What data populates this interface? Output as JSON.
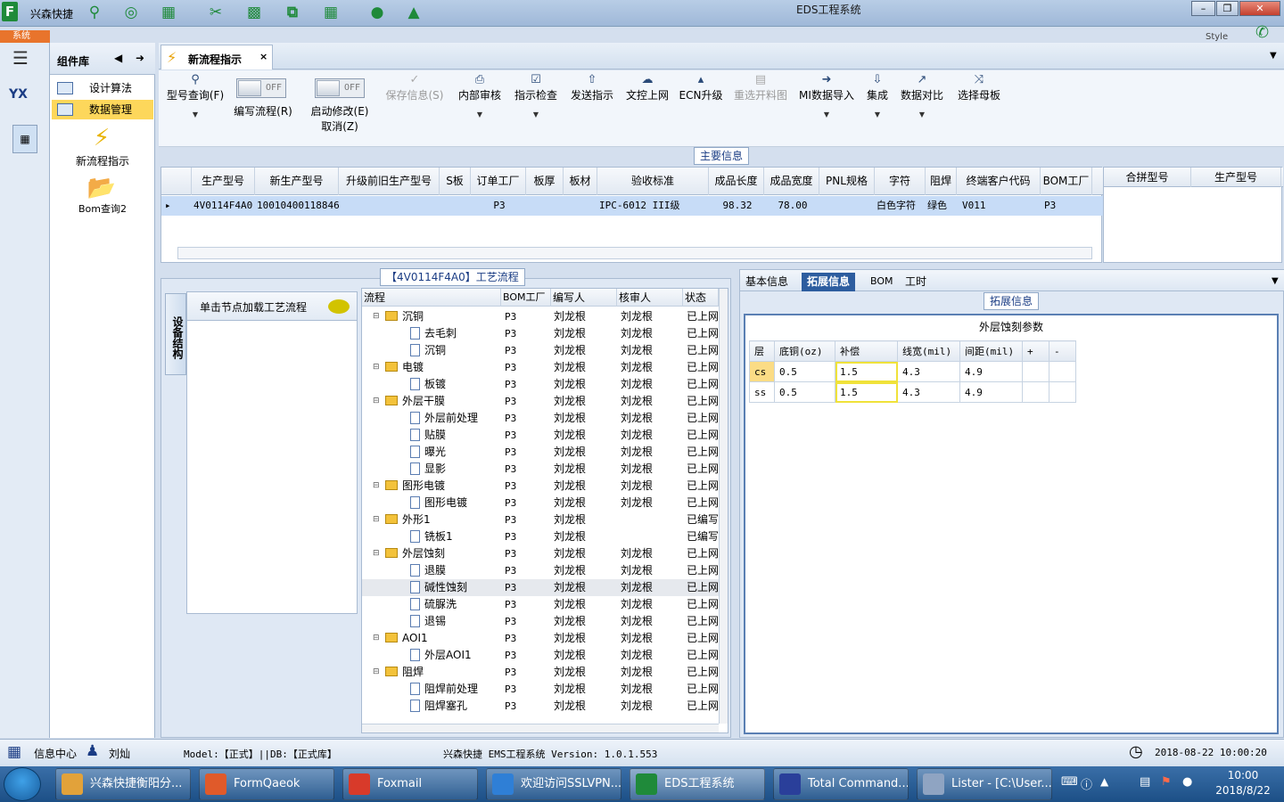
{
  "app": {
    "logo_letter": "F",
    "name": "兴森快捷",
    "window_title": "EDS工程系统",
    "menu_tab": "系统",
    "style_label": "Style"
  },
  "sidebar": {
    "logo_text": "YX",
    "panel_title": "组件库",
    "items": [
      {
        "label": "设计算法"
      },
      {
        "label": "数据管理",
        "selected": true
      }
    ],
    "big_items": [
      {
        "label": "新流程指示",
        "icon": "lightning-icon"
      },
      {
        "label": "Bom查询2",
        "icon": "folder-open-icon"
      }
    ]
  },
  "doc_tab": {
    "label": "新流程指示",
    "close": "×"
  },
  "toolbar": {
    "buttons": [
      {
        "label": "型号查询(F)",
        "icon": "search-icon",
        "dropdown": true
      },
      {
        "label": "编写流程(R)",
        "toggle": "OFF"
      },
      {
        "label": "启动修改(E)",
        "label2": "取消(Z)",
        "toggle": "OFF"
      },
      {
        "label": "保存信息(S)",
        "icon": "check-icon",
        "disabled": true
      },
      {
        "label": "内部审核",
        "icon": "print-icon",
        "dropdown": true
      },
      {
        "label": "指示检查",
        "icon": "checkbox-icon",
        "dropdown": true
      },
      {
        "label": "发送指示",
        "icon": "upload-icon"
      },
      {
        "label": "文控上网",
        "icon": "cloud-upload-icon"
      },
      {
        "label": "ECN升级",
        "icon": "ecn-icon"
      },
      {
        "label": "重选开料图",
        "icon": "image-icon",
        "disabled": true
      },
      {
        "label": "MI数据导入",
        "icon": "import-icon",
        "dropdown": true
      },
      {
        "label": "集成",
        "icon": "download-icon",
        "dropdown": true
      },
      {
        "label": "数据对比",
        "icon": "compare-icon",
        "dropdown": true
      },
      {
        "label": "选择母板",
        "icon": "shuffle-icon"
      }
    ]
  },
  "main_info": {
    "section_label": "主要信息",
    "columns": [
      "生产型号",
      "新生产型号",
      "升级前旧生产型号",
      "S板",
      "订单工厂",
      "板厚",
      "板材",
      "验收标准",
      "成品长度",
      "成品宽度",
      "PNL规格",
      "字符",
      "阻焊",
      "终端客户代码",
      "BOM工厂"
    ],
    "rows": [
      [
        "4V0114F4A0",
        "10010400118846",
        "",
        "",
        "P3",
        "",
        "",
        "IPC-6012 III级",
        "98.32",
        "78.00",
        "",
        "白色字符",
        "绿色",
        "V011",
        "P3"
      ]
    ],
    "merge_columns": [
      "合拼型号",
      "生产型号"
    ]
  },
  "process": {
    "title": "【4V0114F4A0】工艺流程",
    "vertical_tab": "设备结构",
    "node_hint": "单击节点加载工艺流程",
    "columns": [
      "流程",
      "BOM工厂",
      "编写人",
      "核审人",
      "状态"
    ],
    "rows": [
      {
        "name": "沉铜",
        "level": 0,
        "factory": "P3",
        "writer": "刘龙根",
        "reviewer": "刘龙根",
        "status": "已上网"
      },
      {
        "name": "去毛刺",
        "level": 1,
        "factory": "P3",
        "writer": "刘龙根",
        "reviewer": "刘龙根",
        "status": "已上网"
      },
      {
        "name": "沉铜",
        "level": 1,
        "factory": "P3",
        "writer": "刘龙根",
        "reviewer": "刘龙根",
        "status": "已上网"
      },
      {
        "name": "电镀",
        "level": 0,
        "factory": "P3",
        "writer": "刘龙根",
        "reviewer": "刘龙根",
        "status": "已上网"
      },
      {
        "name": "板镀",
        "level": 1,
        "factory": "P3",
        "writer": "刘龙根",
        "reviewer": "刘龙根",
        "status": "已上网"
      },
      {
        "name": "外层干膜",
        "level": 0,
        "factory": "P3",
        "writer": "刘龙根",
        "reviewer": "刘龙根",
        "status": "已上网"
      },
      {
        "name": "外层前处理",
        "level": 1,
        "factory": "P3",
        "writer": "刘龙根",
        "reviewer": "刘龙根",
        "status": "已上网"
      },
      {
        "name": "贴膜",
        "level": 1,
        "factory": "P3",
        "writer": "刘龙根",
        "reviewer": "刘龙根",
        "status": "已上网"
      },
      {
        "name": "曝光",
        "level": 1,
        "factory": "P3",
        "writer": "刘龙根",
        "reviewer": "刘龙根",
        "status": "已上网"
      },
      {
        "name": "显影",
        "level": 1,
        "factory": "P3",
        "writer": "刘龙根",
        "reviewer": "刘龙根",
        "status": "已上网"
      },
      {
        "name": "图形电镀",
        "level": 0,
        "factory": "P3",
        "writer": "刘龙根",
        "reviewer": "刘龙根",
        "status": "已上网"
      },
      {
        "name": "图形电镀",
        "level": 1,
        "factory": "P3",
        "writer": "刘龙根",
        "reviewer": "刘龙根",
        "status": "已上网"
      },
      {
        "name": "外形1",
        "level": 0,
        "factory": "P3",
        "writer": "刘龙根",
        "reviewer": "",
        "status": "已编写"
      },
      {
        "name": "铣板1",
        "level": 1,
        "factory": "P3",
        "writer": "刘龙根",
        "reviewer": "",
        "status": "已编写"
      },
      {
        "name": "外层蚀刻",
        "level": 0,
        "factory": "P3",
        "writer": "刘龙根",
        "reviewer": "刘龙根",
        "status": "已上网"
      },
      {
        "name": "退膜",
        "level": 1,
        "factory": "P3",
        "writer": "刘龙根",
        "reviewer": "刘龙根",
        "status": "已上网"
      },
      {
        "name": "碱性蚀刻",
        "level": 1,
        "factory": "P3",
        "writer": "刘龙根",
        "reviewer": "刘龙根",
        "status": "已上网",
        "highlight": true
      },
      {
        "name": "硫脲洗",
        "level": 1,
        "factory": "P3",
        "writer": "刘龙根",
        "reviewer": "刘龙根",
        "status": "已上网"
      },
      {
        "name": "退锡",
        "level": 1,
        "factory": "P3",
        "writer": "刘龙根",
        "reviewer": "刘龙根",
        "status": "已上网"
      },
      {
        "name": "AOI1",
        "level": 0,
        "factory": "P3",
        "writer": "刘龙根",
        "reviewer": "刘龙根",
        "status": "已上网"
      },
      {
        "name": "外层AOI1",
        "level": 1,
        "factory": "P3",
        "writer": "刘龙根",
        "reviewer": "刘龙根",
        "status": "已上网"
      },
      {
        "name": "阻焊",
        "level": 0,
        "factory": "P3",
        "writer": "刘龙根",
        "reviewer": "刘龙根",
        "status": "已上网"
      },
      {
        "name": "阻焊前处理",
        "level": 1,
        "factory": "P3",
        "writer": "刘龙根",
        "reviewer": "刘龙根",
        "status": "已上网"
      },
      {
        "name": "阻焊塞孔",
        "level": 1,
        "factory": "P3",
        "writer": "刘龙根",
        "reviewer": "刘龙根",
        "status": "已上网"
      }
    ]
  },
  "right_tabs": [
    {
      "label": "基本信息"
    },
    {
      "label": "拓展信息",
      "selected": true
    },
    {
      "label": "BOM"
    },
    {
      "label": "工时"
    }
  ],
  "ext_info": {
    "section_label": "拓展信息",
    "table_title": "外层蚀刻参数",
    "columns": [
      "层",
      "底铜(oz)",
      "补偿",
      "线宽(mil)",
      "间距(mil)",
      "+",
      "-"
    ],
    "rows": [
      [
        "cs",
        "0.5",
        "1.5",
        "4.3",
        "4.9",
        "",
        ""
      ],
      [
        "ss",
        "0.5",
        "1.5",
        "4.3",
        "4.9",
        "",
        ""
      ]
    ]
  },
  "status_bar": {
    "info_center": "信息中心",
    "user": "刘灿",
    "model": "Model:【正式】||DB:【正式库】",
    "system": "兴森快捷 EMS工程系统 Version: 1.0.1.553",
    "datetime": "2018-08-22 10:00:20"
  },
  "taskbar": {
    "tasks": [
      {
        "label": "兴森快捷衡阳分...",
        "color": "#e2a23a"
      },
      {
        "label": "FormQaeok",
        "color": "#e05a2a"
      },
      {
        "label": "Foxmail",
        "color": "#d83a2a"
      },
      {
        "label": "欢迎访问SSLVPN...",
        "color": "#2f7fd6"
      },
      {
        "label": "EDS工程系统",
        "color": "#1f8a3a",
        "active": true
      },
      {
        "label": "Total Command...",
        "color": "#2a3f9a"
      },
      {
        "label": "Lister - [C:\\User...",
        "color": "#8fa4c2"
      }
    ],
    "time": "10:00",
    "date": "2018/8/22"
  }
}
